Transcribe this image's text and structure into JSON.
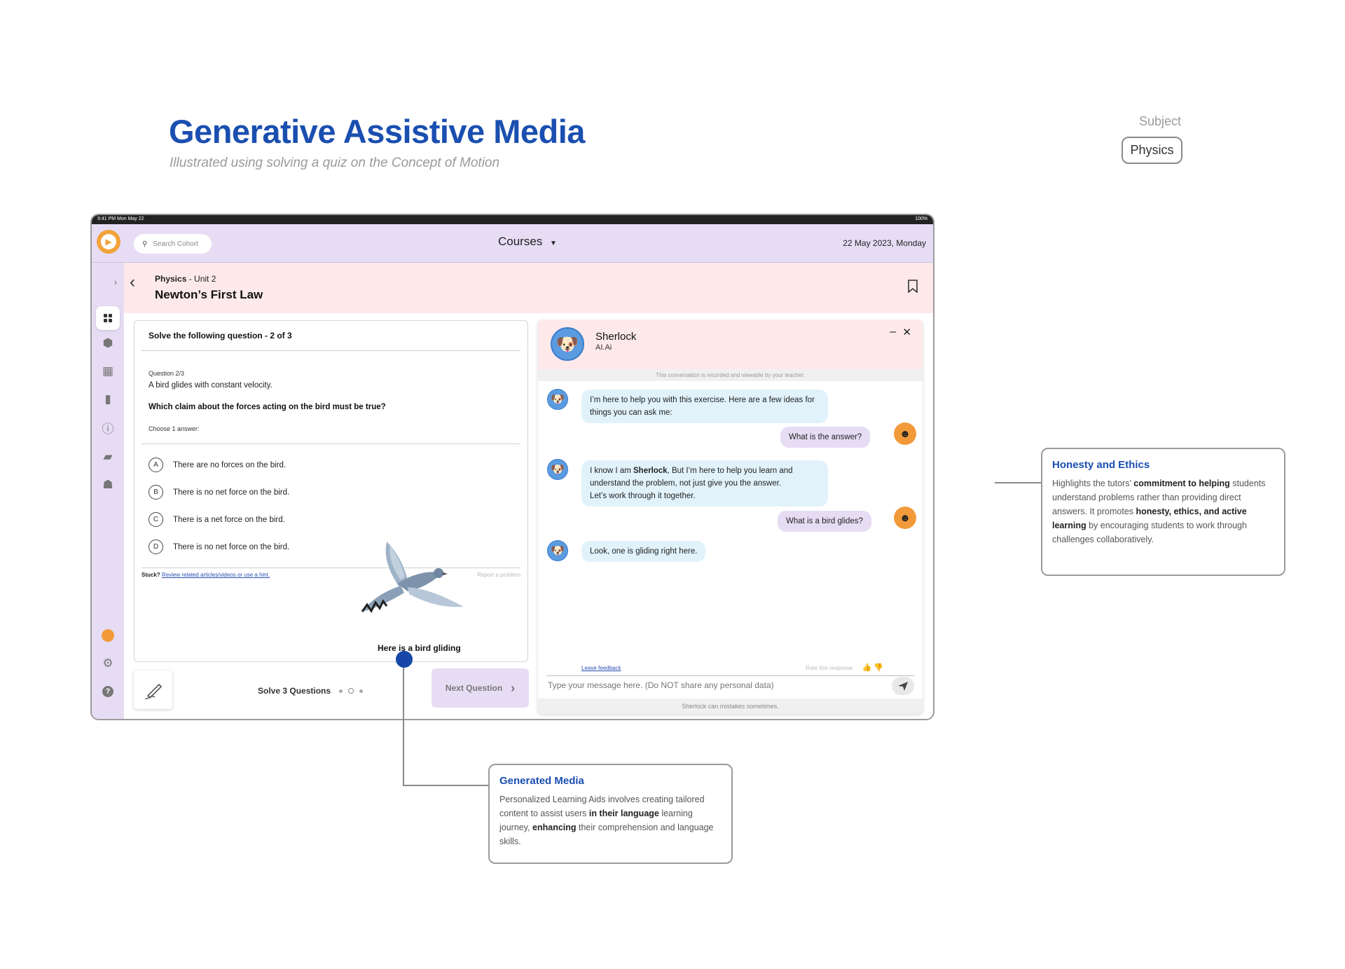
{
  "header": {
    "title": "Generative Assistive Media",
    "subtitle": "Illustrated using solving a quiz on the Concept of Motion",
    "subject_label": "Subject",
    "subject_value": "Physics"
  },
  "device": {
    "status_time": "9:41 PM   Mon May 22",
    "status_right": "100%"
  },
  "topbar": {
    "search_placeholder": "Search Cohort",
    "courses_label": "Courses",
    "date": "22 May 2023, Monday"
  },
  "sidebar": {
    "items": [
      "dashboard-icon",
      "cube-icon",
      "calculator-icon",
      "book-icon",
      "info-icon",
      "chat-icon",
      "group-icon"
    ],
    "bottom": [
      "avatar",
      "gear-icon",
      "help-icon"
    ]
  },
  "lesson": {
    "subject": "Physics",
    "unit": " - Unit 2",
    "title": "Newton’s First Law"
  },
  "quiz": {
    "heading": "Solve the following question - 2 of 3",
    "question_number": "Question 2/3",
    "stem": "A bird glides with constant velocity.",
    "prompt": "Which claim about the forces acting on the bird must be true?",
    "choose": "Choose 1 answer:",
    "options": [
      {
        "letter": "A",
        "text": "There are no forces on the bird."
      },
      {
        "letter": "B",
        "text": "There is no net force on the bird."
      },
      {
        "letter": "C",
        "text": "There is a net force on the bird."
      },
      {
        "letter": "D",
        "text": "There is no net force on the bird."
      }
    ],
    "stuck_label": "Stuck?",
    "stuck_link": "Review related articles/videos or use a hint.",
    "report": "Report a problem",
    "media_caption": "Here is a bird gliding",
    "solve_label": "Solve 3 Questions",
    "next_label": "Next Question"
  },
  "chat": {
    "bot_name": "Sherlock",
    "bot_sub": "AI.Ai",
    "recorded_notice": "This conversation is recorded and viewable by your teacher.",
    "messages": [
      {
        "from": "bot",
        "text": "I’m here to help you with this exercise. Here are a few ideas for things you can ask me:"
      },
      {
        "from": "user",
        "text": "What is the answer?"
      },
      {
        "from": "bot",
        "pre": "I know I am ",
        "bold": "Sherlock",
        "post": ", But I’m here to help you learn and understand the problem, not just give you the answer.",
        "line2": "Let’s work through it together."
      },
      {
        "from": "user",
        "text": "What is a bird glides?"
      },
      {
        "from": "bot",
        "text": "Look, one is gliding right here."
      }
    ],
    "leave_feedback": "Leave feedback",
    "rate_response": "Rate this response",
    "input_placeholder": "Type your message here. (Do NOT share any personal data)",
    "footer": "Sherlock can mistakes sometimes."
  },
  "callouts": {
    "ethics": {
      "title": "Honesty and Ethics",
      "p1": "Highlights the tutors’ ",
      "b1": "commitment to helping",
      "p2": " students understand problems rather than providing direct answers. It promotes ",
      "b2": "honesty, ethics, and active learning",
      "p3": " by encouraging students to work through challenges collaboratively."
    },
    "media": {
      "title": "Generated Media",
      "p1": "Personalized Learning Aids involves creating tailored content to assist users ",
      "b1": "in their language",
      "p2": " learning journey, ",
      "b2": "enhancing",
      "p3": " their comprehension and language skills."
    }
  },
  "colors": {
    "accent": "#1a4fb0",
    "topbar": "#e6ddf5",
    "lesson_header": "#fde9ea",
    "bot_bubble": "#e1f2fb",
    "marker": "#1646a8"
  }
}
